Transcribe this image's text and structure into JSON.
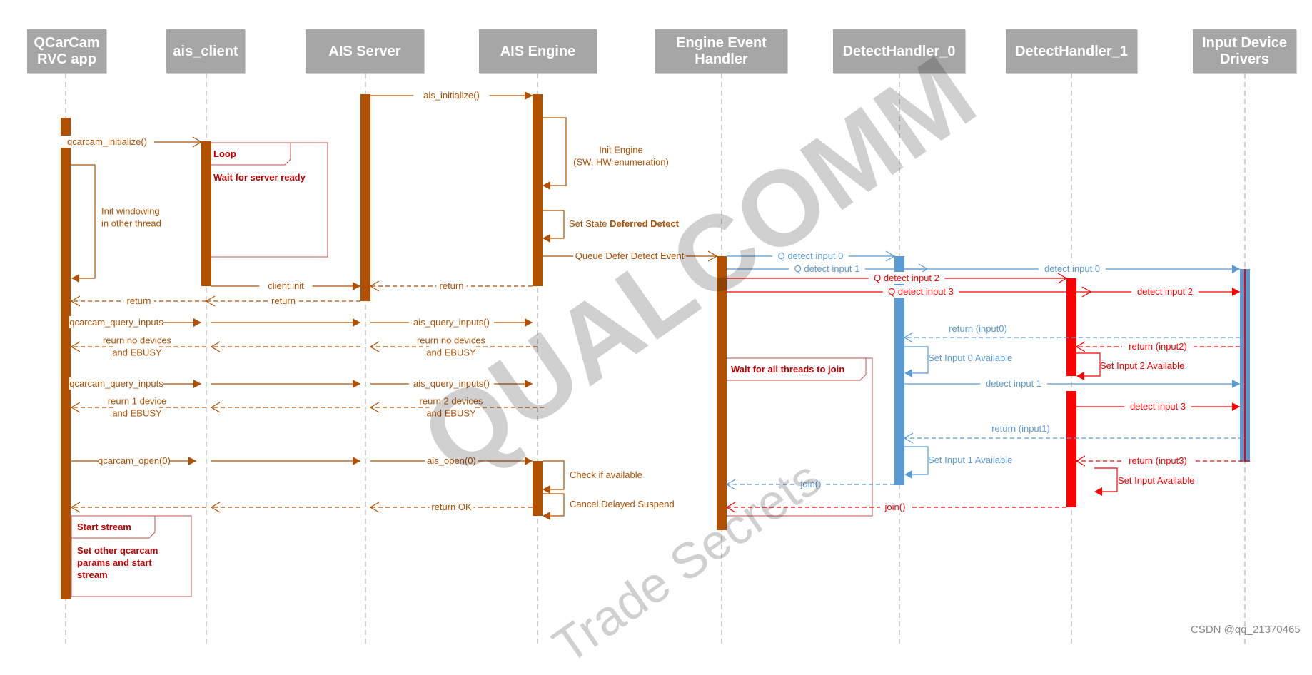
{
  "colors": {
    "brown": "#b05000",
    "blue": "#5b9bd5",
    "red": "#ff0000",
    "header": "#a6a6a6",
    "lifeline": "#a0a0a0"
  },
  "participants": [
    {
      "id": "app",
      "label": "QCarCam\nRVC app"
    },
    {
      "id": "client",
      "label": "ais_client"
    },
    {
      "id": "server",
      "label": "AIS Server"
    },
    {
      "id": "engine",
      "label": "AIS Engine"
    },
    {
      "id": "eeh",
      "label": "Engine Event\nHandler"
    },
    {
      "id": "dh0",
      "label": "DetectHandler_0"
    },
    {
      "id": "dh1",
      "label": "DetectHandler_1"
    },
    {
      "id": "idd",
      "label": "Input Device\nDrivers"
    }
  ],
  "messages": [
    {
      "from": "server",
      "to": "engine",
      "label": "ais_initialize()",
      "kind": "sync",
      "color": "brown"
    },
    {
      "from": "app",
      "to": "client",
      "label": "qcarcam_initialize()",
      "kind": "async",
      "color": "brown"
    },
    {
      "from": "client",
      "to": "server",
      "label": "client init",
      "kind": "sync",
      "color": "brown"
    },
    {
      "from": "engine",
      "to": "server",
      "label": "return",
      "kind": "reply",
      "color": "brown"
    },
    {
      "from": "server",
      "to": "client",
      "label": "return",
      "kind": "reply",
      "color": "brown"
    },
    {
      "from": "client",
      "to": "app",
      "label": "return",
      "kind": "reply",
      "color": "brown"
    },
    {
      "from": "engine",
      "to": "eeh",
      "label": "Queue Defer Detect Event",
      "kind": "async",
      "color": "brown"
    },
    {
      "from": "app",
      "to": "client",
      "label": "qcarcam_query_inputs",
      "kind": "sync",
      "color": "brown"
    },
    {
      "from": "client",
      "to": "server",
      "label": "",
      "kind": "sync",
      "color": "brown"
    },
    {
      "from": "server",
      "to": "engine",
      "label": "ais_query_inputs()",
      "kind": "sync",
      "color": "brown"
    },
    {
      "from": "engine",
      "to": "server",
      "label": "reurn no devices\nand EBUSY",
      "kind": "reply",
      "color": "brown"
    },
    {
      "from": "server",
      "to": "client",
      "label": "",
      "kind": "reply",
      "color": "brown"
    },
    {
      "from": "client",
      "to": "app",
      "label": "reurn no devices\nand EBUSY",
      "kind": "reply",
      "color": "brown"
    },
    {
      "from": "app",
      "to": "client",
      "label": "qcarcam_query_inputs",
      "kind": "sync",
      "color": "brown"
    },
    {
      "from": "client",
      "to": "server",
      "label": "",
      "kind": "sync",
      "color": "brown"
    },
    {
      "from": "server",
      "to": "engine",
      "label": "ais_query_inputs()",
      "kind": "sync",
      "color": "brown"
    },
    {
      "from": "engine",
      "to": "server",
      "label": "reurn 2 devices\nand EBUSY",
      "kind": "reply",
      "color": "brown"
    },
    {
      "from": "server",
      "to": "client",
      "label": "",
      "kind": "reply",
      "color": "brown"
    },
    {
      "from": "client",
      "to": "app",
      "label": "reurn 1 device\nand EBUSY",
      "kind": "reply",
      "color": "brown"
    },
    {
      "from": "app",
      "to": "client",
      "label": "qcarcam_open(0)",
      "kind": "sync",
      "color": "brown"
    },
    {
      "from": "client",
      "to": "server",
      "label": "",
      "kind": "sync",
      "color": "brown"
    },
    {
      "from": "server",
      "to": "engine",
      "label": "ais_open(0)",
      "kind": "sync",
      "color": "brown"
    },
    {
      "from": "engine",
      "to": "server",
      "label": "return OK",
      "kind": "reply",
      "color": "brown"
    },
    {
      "from": "server",
      "to": "client",
      "label": "",
      "kind": "reply",
      "color": "brown"
    },
    {
      "from": "client",
      "to": "app",
      "label": "",
      "kind": "reply",
      "color": "brown"
    },
    {
      "from": "eeh",
      "to": "dh0",
      "label": "Q detect input 0",
      "kind": "async",
      "color": "blue"
    },
    {
      "from": "eeh",
      "to": "dh1",
      "label": "Q detect input 1",
      "kind": "async",
      "color": "blue"
    },
    {
      "from": "dh0",
      "to": "idd",
      "label": "detect input 0",
      "kind": "sync",
      "color": "blue"
    },
    {
      "from": "eeh",
      "to": "dh1",
      "label": "Q detect input 2",
      "kind": "async",
      "color": "red"
    },
    {
      "from": "eeh",
      "to": "dh1",
      "label": "Q detect input 3",
      "kind": "async",
      "color": "red"
    },
    {
      "from": "dh1",
      "to": "idd",
      "label": "detect input 2",
      "kind": "sync",
      "color": "red"
    },
    {
      "from": "idd",
      "to": "dh0",
      "label": "return (input0)",
      "kind": "reply",
      "color": "blue"
    },
    {
      "from": "idd",
      "to": "dh1",
      "label": "return (input2)",
      "kind": "reply",
      "color": "red"
    },
    {
      "from": "dh0",
      "to": "idd",
      "label": "detect input 1",
      "kind": "sync",
      "color": "blue"
    },
    {
      "from": "dh1",
      "to": "idd",
      "label": "detect input 3",
      "kind": "sync",
      "color": "red"
    },
    {
      "from": "idd",
      "to": "dh0",
      "label": "return (input1)",
      "kind": "reply",
      "color": "blue"
    },
    {
      "from": "idd",
      "to": "dh1",
      "label": "return (input3)",
      "kind": "reply",
      "color": "red"
    },
    {
      "from": "dh0",
      "to": "eeh",
      "label": "join()",
      "kind": "reply",
      "color": "blue"
    },
    {
      "from": "dh1",
      "to": "eeh",
      "label": "join()",
      "kind": "reply",
      "color": "red"
    }
  ],
  "self_calls": [
    {
      "on": "app",
      "label": "Init windowing\nin other thread",
      "bold": "",
      "color": "brown"
    },
    {
      "on": "engine",
      "label": "Init Engine\n(SW, HW enumeration)",
      "bold": "",
      "color": "brown"
    },
    {
      "on": "engine",
      "label": "Set State ",
      "bold": "Deferred Detect",
      "color": "brown"
    },
    {
      "on": "engine",
      "label": "Check if available",
      "bold": "",
      "color": "brown"
    },
    {
      "on": "engine",
      "label": "Cancel Delayed Suspend",
      "bold": "",
      "color": "brown"
    },
    {
      "on": "dh0",
      "label": "Set Input 0 Available",
      "bold": "",
      "color": "blue"
    },
    {
      "on": "dh1",
      "label": "Set Input 2 Available",
      "bold": "",
      "color": "red"
    },
    {
      "on": "dh0",
      "label": "Set Input 1 Available",
      "bold": "",
      "color": "blue"
    },
    {
      "on": "dh1",
      "label": "Set Input Available",
      "bold": "",
      "color": "red"
    }
  ],
  "fragments": [
    {
      "tag": "Loop",
      "text": "Wait for server ready"
    },
    {
      "tag": "Start stream",
      "text": "Set other qcarcam\nparams and start\nstream"
    },
    {
      "tag": "Wait for all threads to join",
      "text": ""
    }
  ],
  "watermark": {
    "main": "QUALCOMM",
    "sub": "Trade Secrets"
  },
  "credit": "CSDN @qq_21370465"
}
